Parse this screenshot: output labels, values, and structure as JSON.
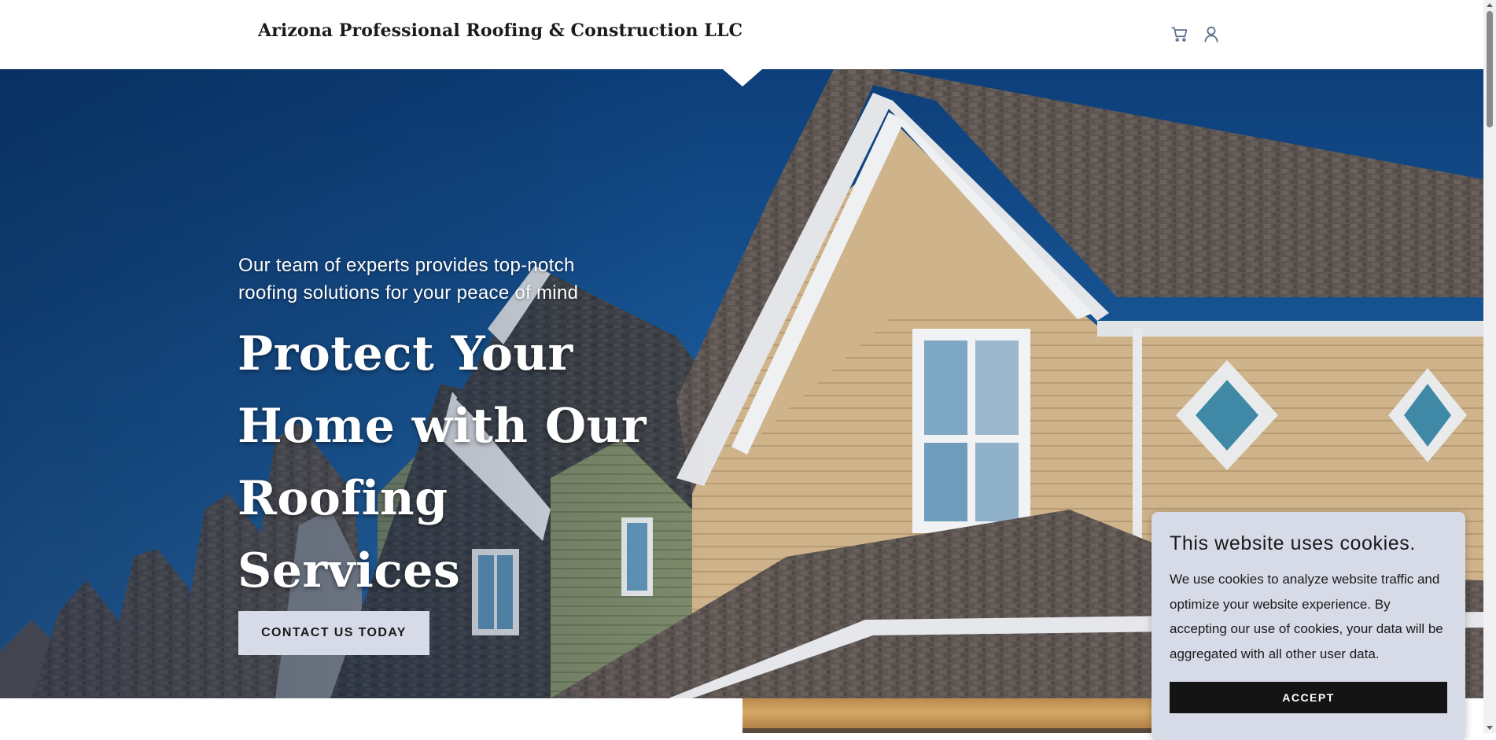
{
  "header": {
    "brand": "Arizona Professional Roofing & Construction LLC",
    "cart_icon": "shopping-cart-icon",
    "account_icon": "user-account-icon"
  },
  "hero": {
    "subtitle": "Our team of experts provides top-notch roofing solutions for your peace of mind",
    "headline": "Protect Your Home with Our Roofing Services",
    "cta_label": "CONTACT US TODAY",
    "background_image": "row of suburban houses with gabled shingle roofs under a blue sky"
  },
  "cookie_banner": {
    "title": "This website uses cookies.",
    "body": "We use cookies to analyze website traffic and optimize your website experience. By accepting our use of cookies, your data will be aggregated with all other user data.",
    "accept_label": "ACCEPT"
  },
  "colors": {
    "header_bg": "#ffffff",
    "brand_text": "#1b1b1b",
    "icon_color": "#5b6f8c",
    "cta_bg": "#d6dbe7",
    "cookie_bg": "#d6dbe7",
    "accept_bg": "#141414"
  }
}
